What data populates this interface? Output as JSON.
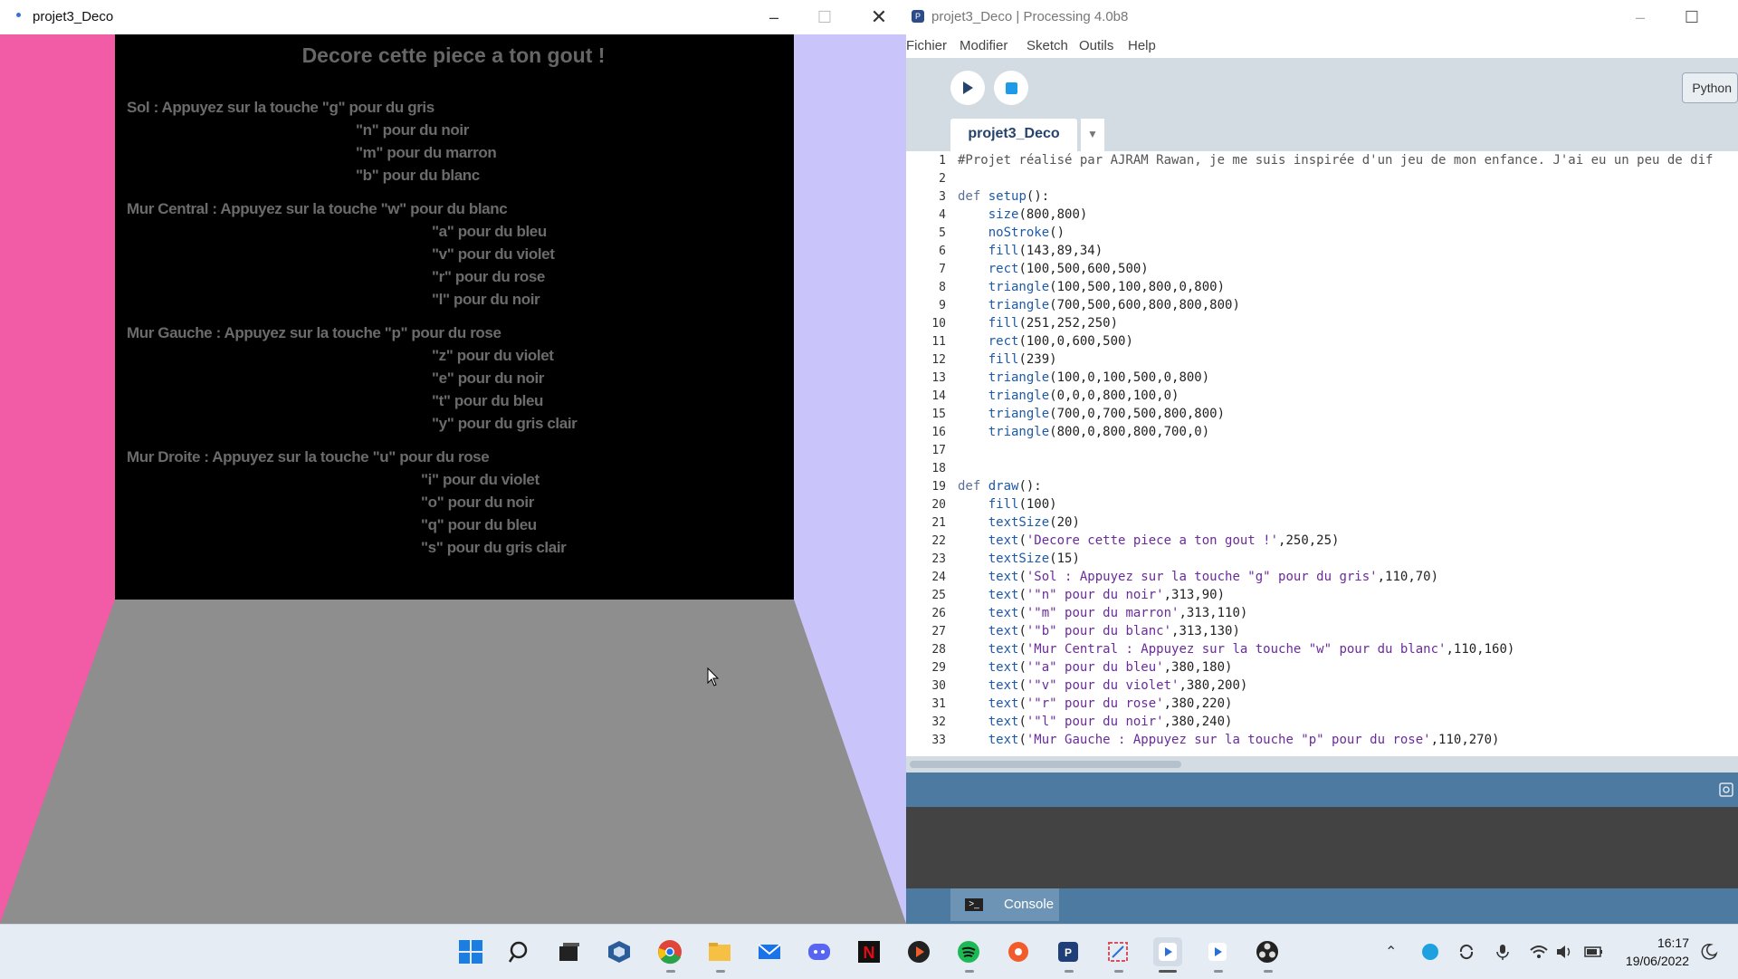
{
  "sketch_window": {
    "title": "projet3_Deco",
    "canvas": {
      "title": "Decore cette piece a ton gout !",
      "lines": [
        "Sol : Appuyez sur la touche \"g\" pour du gris",
        "\"n\" pour du noir",
        "\"m\" pour du marron",
        "\"b\" pour du blanc",
        "Mur Central : Appuyez sur la touche \"w\" pour du blanc",
        "\"a\" pour du bleu",
        "\"v\" pour du violet",
        "\"r\" pour du rose",
        "\"l\" pour du noir",
        "Mur Gauche : Appuyez sur la touche \"p\" pour du rose",
        "\"z\" pour du violet",
        "\"e\" pour du noir",
        "\"t\" pour du bleu",
        "\"y\" pour du gris clair",
        "Mur Droite : Appuyez sur la touche \"u\" pour du rose",
        "\"i\" pour du violet",
        "\"o\" pour du noir",
        "\"q\" pour du bleu",
        "\"s\" pour du gris clair"
      ],
      "colors": {
        "left_wall": "#f25ba5",
        "right_wall": "#c9c5fb",
        "back_wall": "#000000",
        "floor": "#8e8e8e"
      }
    }
  },
  "ide": {
    "title": "projet3_Deco | Processing 4.0b8",
    "menu": [
      "Fichier",
      "Modifier",
      "Sketch",
      "Outils",
      "Help"
    ],
    "mode": "Python",
    "tab": "projet3_Deco",
    "console_label": "Console",
    "code_lines": [
      "#Projet réalisé par AJRAM Rawan, je me suis inspirée d'un jeu de mon enfance. J'ai eu un peu de dif",
      "",
      "def setup():",
      "    size(800,800)",
      "    noStroke()",
      "    fill(143,89,34)",
      "    rect(100,500,600,500)",
      "    triangle(100,500,100,800,0,800)",
      "    triangle(700,500,600,800,800,800)",
      "    fill(251,252,250)",
      "    rect(100,0,600,500)",
      "    fill(239)",
      "    triangle(100,0,100,500,0,800)",
      "    triangle(0,0,0,800,100,0)",
      "    triangle(700,0,700,500,800,800)",
      "    triangle(800,0,800,800,700,0)",
      "",
      "",
      "def draw():",
      "    fill(100)",
      "    textSize(20)",
      "    text('Decore cette piece a ton gout !',250,25)",
      "    textSize(15)",
      "    text('Sol : Appuyez sur la touche \"g\" pour du gris',110,70)",
      "    text('\"n\" pour du noir',313,90)",
      "    text('\"m\" pour du marron',313,110)",
      "    text('\"b\" pour du blanc',313,130)",
      "    text('Mur Central : Appuyez sur la touche \"w\" pour du blanc',110,160)",
      "    text('\"a\" pour du bleu',380,180)",
      "    text('\"v\" pour du violet',380,200)",
      "    text('\"r\" pour du rose',380,220)",
      "    text('\"l\" pour du noir',380,240)",
      "    text('Mur Gauche : Appuyez sur la touche \"p\" pour du rose',110,270)"
    ]
  },
  "taskbar": {
    "apps": [
      "windows-start",
      "search",
      "task-view",
      "virtualbox",
      "chrome",
      "file-explorer",
      "mail",
      "discord",
      "netflix",
      "media-player",
      "spotify",
      "app-orange",
      "processing",
      "snipping-tool",
      "processing-sketch-1",
      "processing-sketch-2",
      "obs"
    ],
    "time": "16:17",
    "date": "19/06/2022"
  }
}
